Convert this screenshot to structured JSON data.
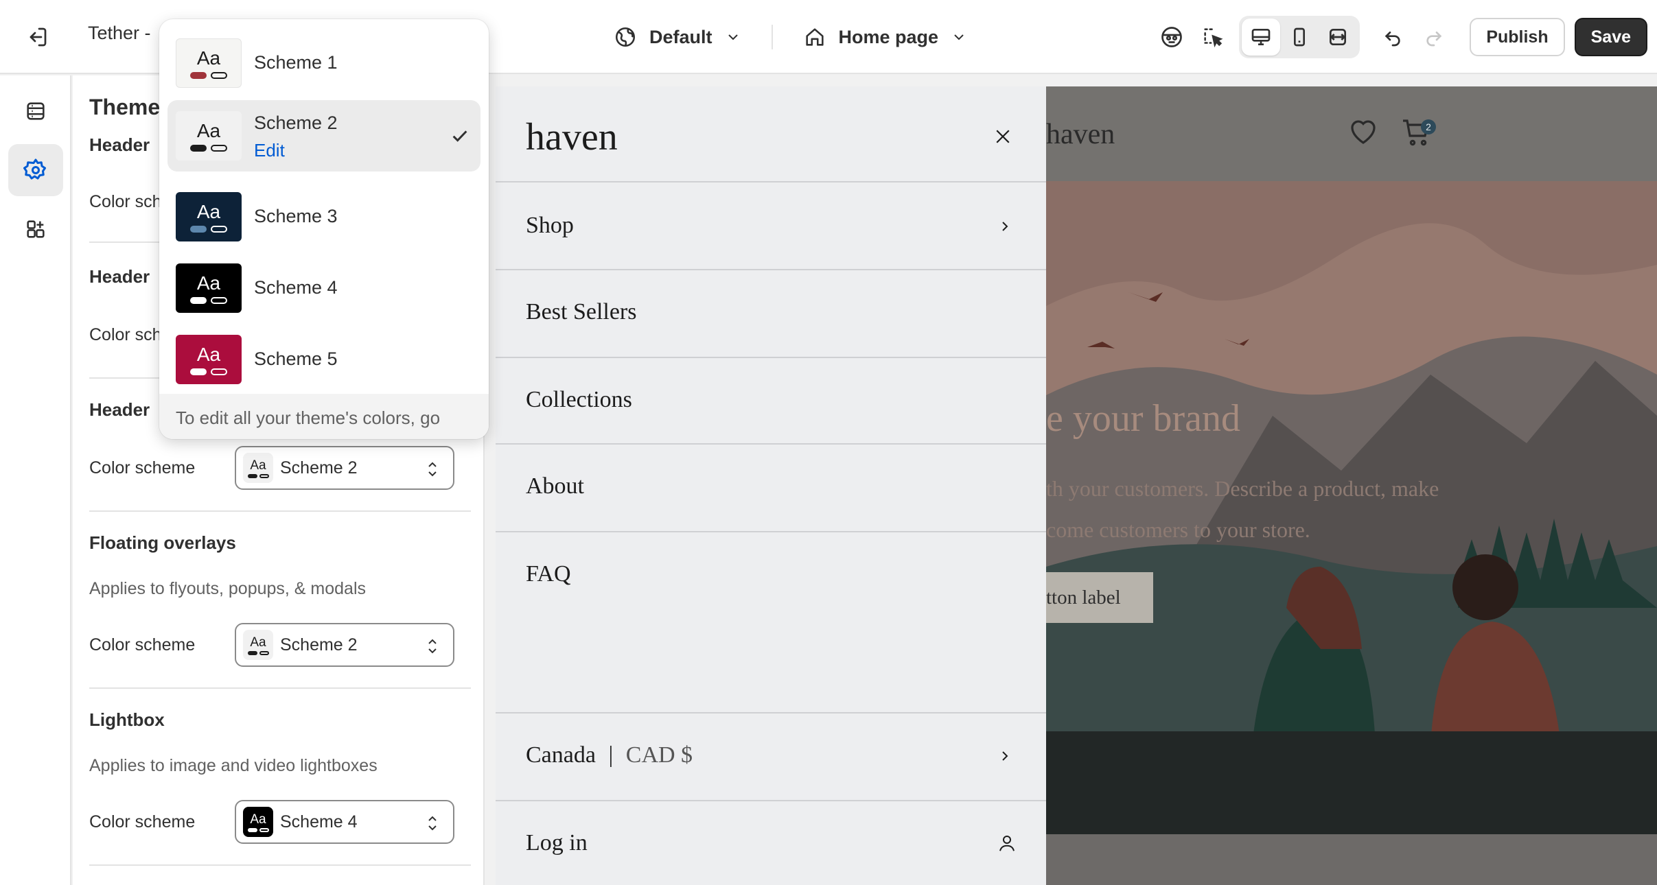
{
  "topbar": {
    "store_name": "Tether -",
    "theme_selector": "Default",
    "page_selector": "Home page",
    "publish_label": "Publish",
    "save_label": "Save"
  },
  "panel": {
    "title": "Theme",
    "sections": {
      "header_partial_1": "Header",
      "header_partial_2": "Header",
      "header_partial_3": "Header",
      "color_label_partial": "Color sch",
      "color_label": "Color scheme",
      "header3_value": "Scheme 2",
      "floating": {
        "title": "Floating overlays",
        "desc": "Applies to flyouts, popups, & modals",
        "value": "Scheme 2"
      },
      "lightbox": {
        "title": "Lightbox",
        "desc": "Applies to image and video lightboxes",
        "value": "Scheme 4"
      }
    }
  },
  "dropdown": {
    "swatch_text": "Aa",
    "options": [
      {
        "label": "Scheme 1",
        "bg": "#f5f5f3",
        "text": "#1c1c1c",
        "pill1": "#a0343a",
        "pill2": "#1c1c1c"
      },
      {
        "label": "Scheme 2",
        "bg": "#f1f1f1",
        "text": "#1c1c1c",
        "pill1": "#1c1c1c",
        "pill2": "#1c1c1c",
        "selected": true,
        "edit": "Edit"
      },
      {
        "label": "Scheme 3",
        "bg": "#0d2238",
        "text": "#ffffff",
        "pill1": "#5d87ad",
        "pill2": "#ffffff"
      },
      {
        "label": "Scheme 4",
        "bg": "#000000",
        "text": "#ffffff",
        "pill1": "#ffffff",
        "pill2": "#ffffff"
      },
      {
        "label": "Scheme 5",
        "bg": "#ab0d3d",
        "text": "#ffffff",
        "pill1": "#ffffff",
        "pill2": "#ffffff"
      }
    ],
    "footer": "To edit all your theme's colors, go"
  },
  "preview": {
    "drawer_logo": "haven",
    "nav": [
      "Shop",
      "Best Sellers",
      "Collections",
      "About",
      "FAQ"
    ],
    "country": "Canada",
    "currency": "CAD $",
    "login": "Log in",
    "hero_logo": "haven",
    "cart_count": "2",
    "hero_title": "e your brand",
    "hero_sub_1": "th your customers. Describe a product, make",
    "hero_sub_2": "come customers to your store.",
    "hero_button": "tton label"
  }
}
